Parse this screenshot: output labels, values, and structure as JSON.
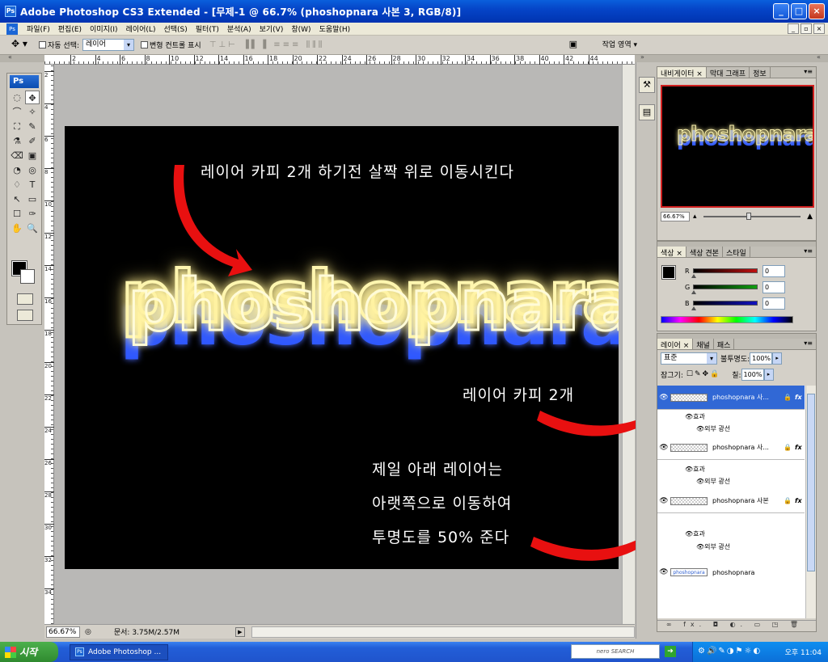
{
  "window": {
    "title": "Adobe Photoshop CS3 Extended - [무제-1 @ 66.7% (phoshopnara 사본 3, RGB/8)]",
    "app_icon": "Ps",
    "buttons": {
      "minimize": "_",
      "maximize": "□",
      "close": "×"
    }
  },
  "menu": {
    "items": [
      "파일(F)",
      "편집(E)",
      "이미지(I)",
      "레이어(L)",
      "선택(S)",
      "필터(T)",
      "분석(A)",
      "보기(V)",
      "창(W)",
      "도움말(H)"
    ],
    "mdi": [
      "_",
      "▫",
      "×"
    ]
  },
  "options": {
    "auto_select_label": "자동 선택:",
    "auto_select_value": "레이어",
    "transform_label": "변형 컨트롤 표시",
    "workspace_label": "작업 영역 ▾",
    "tool_icon": "move-tool-icon"
  },
  "ruler": {
    "h_ticks": [
      "2",
      "4",
      "6",
      "8",
      "10",
      "12",
      "14",
      "16",
      "18",
      "20",
      "22",
      "24",
      "26",
      "28",
      "30",
      "32",
      "34",
      "36",
      "38",
      "40",
      "42",
      "44"
    ],
    "v_ticks": [
      "2",
      "4",
      "6",
      "8",
      "10",
      "12",
      "14",
      "16",
      "18",
      "20",
      "22",
      "24",
      "26",
      "28",
      "30",
      "32",
      "34"
    ]
  },
  "toolbox": {
    "logo": "Ps",
    "tools": [
      "◌",
      "✥",
      "⌒",
      "✧",
      "⛶",
      "✎",
      "⚗",
      "✐",
      "⌫",
      "▣",
      "◔",
      "◎",
      "♢",
      "T",
      "↖",
      "▭",
      "☐",
      "✑",
      "✋",
      "🔍"
    ]
  },
  "canvas": {
    "logo_text": "phoshopnara",
    "annotation_top": "레이어 카피 2개 하기전 살짝 위로 이동시킨다",
    "annotation_copies": "레이어 카피 2개",
    "annotation_bottom_1": "제일 아래 레이어는",
    "annotation_bottom_2": "아랫쪽으로 이동하여",
    "annotation_bottom_3": "투명도를 50% 준다",
    "arrow_color": "#e81010",
    "glow_color": "#fff6b0",
    "shadow_color": "#3a5cff"
  },
  "status": {
    "zoom": "66.67%",
    "doc_size": "문서: 3.75M/2.57M"
  },
  "navigator": {
    "tabs": [
      "내비게이터 ×",
      "막대 그래프",
      "정보"
    ],
    "preview_text": "phoshopnara",
    "zoom": "66.67%"
  },
  "color_panel": {
    "tabs": [
      "색상 ×",
      "색상 견본",
      "스타일"
    ],
    "rows": [
      {
        "label": "R",
        "value": "0",
        "color": "#c01010"
      },
      {
        "label": "G",
        "value": "0",
        "color": "#10a010"
      },
      {
        "label": "B",
        "value": "0",
        "color": "#1010c0"
      }
    ]
  },
  "layers_panel": {
    "tabs": [
      "레이어 ×",
      "채널",
      "패스"
    ],
    "blend_mode": "표준",
    "opacity_label": "불투명도:",
    "opacity": "100%",
    "lock_label": "잠그기:",
    "fill_label": "칠:",
    "fill": "100%",
    "effects_label": "효과",
    "outer_glow": "외부 광선",
    "layers": [
      {
        "name": "phoshopnara 사...",
        "selected": true
      },
      {
        "name": "phoshopnara 사...",
        "selected": false
      },
      {
        "name": "phoshopnara 사본",
        "selected": false
      },
      {
        "name": "phoshopnara",
        "selected": false
      }
    ],
    "text_thumb": "phoshopnara",
    "footer": "∞ fx. ◘ ◐. ▭ ◳ 🗑"
  },
  "taskbar": {
    "start": "시작",
    "task": "Adobe Photoshop ...",
    "search": "nero SEARCH",
    "clock": "오후 11:04"
  }
}
